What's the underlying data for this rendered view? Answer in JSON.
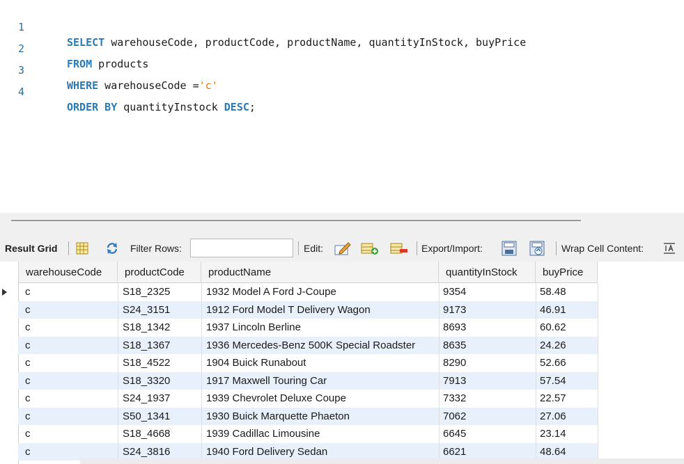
{
  "editor": {
    "lines": [
      {
        "num": "1",
        "keyword": "SELECT",
        "rest": " warehouseCode, productCode, productName, quantityInStock, buyPrice"
      },
      {
        "num": "2",
        "keyword": "FROM",
        "rest": " products"
      },
      {
        "num": "3",
        "keyword": "WHERE",
        "rest": " warehouseCode =",
        "string": "'c'"
      },
      {
        "num": "4",
        "keyword": "ORDER BY",
        "rest": " quantityInstock ",
        "keyword2": "DESC",
        "tail": ";"
      }
    ]
  },
  "toolbar": {
    "result_grid": "Result Grid",
    "filter_rows": "Filter Rows:",
    "filter_value": "",
    "edit": "Edit:",
    "export_import": "Export/Import:",
    "wrap_cell": "Wrap Cell Content:"
  },
  "grid": {
    "columns": [
      "warehouseCode",
      "productCode",
      "productName",
      "quantityInStock",
      "buyPrice"
    ],
    "rows": [
      [
        "c",
        "S18_2325",
        "1932 Model A Ford J-Coupe",
        "9354",
        "58.48"
      ],
      [
        "c",
        "S24_3151",
        "1912 Ford Model T Delivery Wagon",
        "9173",
        "46.91"
      ],
      [
        "c",
        "S18_1342",
        "1937 Lincoln Berline",
        "8693",
        "60.62"
      ],
      [
        "c",
        "S18_1367",
        "1936 Mercedes-Benz 500K Special Roadster",
        "8635",
        "24.26"
      ],
      [
        "c",
        "S18_4522",
        "1904 Buick Runabout",
        "8290",
        "52.66"
      ],
      [
        "c",
        "S18_3320",
        "1917 Maxwell Touring Car",
        "7913",
        "57.54"
      ],
      [
        "c",
        "S24_1937",
        "1939 Chevrolet Deluxe Coupe",
        "7332",
        "22.57"
      ],
      [
        "c",
        "S50_1341",
        "1930 Buick Marquette Phaeton",
        "7062",
        "27.06"
      ],
      [
        "c",
        "S18_4668",
        "1939 Cadillac Limousine",
        "6645",
        "23.14"
      ],
      [
        "c",
        "S24_3816",
        "1940 Ford Delivery Sedan",
        "6621",
        "48.64"
      ]
    ]
  },
  "colors": {
    "keyword": "#2a7ab6",
    "string": "#e07b12",
    "line_number": "#2b6fa0",
    "alt_row": "#e8f0fb"
  }
}
